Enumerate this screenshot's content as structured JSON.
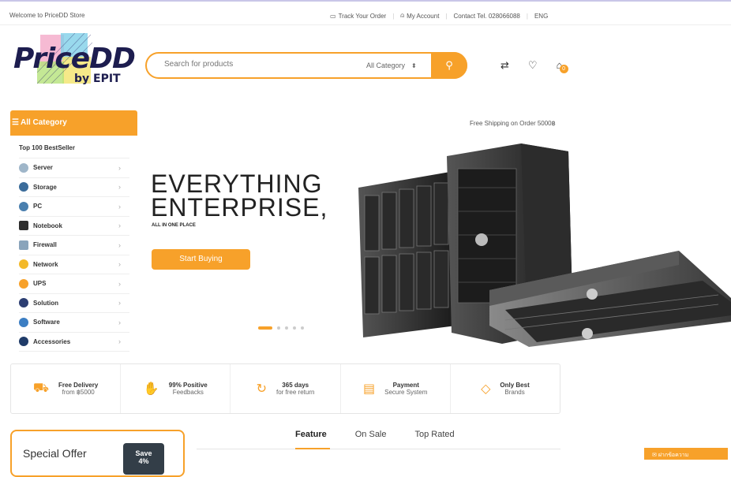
{
  "topbar": {
    "welcome": "Welcome to PriceDD Store",
    "track": "Track Your Order",
    "account": "My Account",
    "contact": "Contact Tel. 028066088",
    "lang": "ENG"
  },
  "logo": {
    "text": "PriceDD",
    "sub": "by EPIT"
  },
  "search": {
    "placeholder": "Search for products",
    "category": "All Category"
  },
  "header": {
    "cart_count": "0"
  },
  "sidebar": {
    "all_category": "All Category",
    "top100": "Top 100 BestSeller",
    "items": [
      {
        "label": "Server",
        "color": "#9fb6c9"
      },
      {
        "label": "Storage",
        "color": "#3b6c9a"
      },
      {
        "label": "PC",
        "color": "#4a7fae"
      },
      {
        "label": "Notebook",
        "color": "#2d2d2d"
      },
      {
        "label": "Firewall",
        "color": "#8aa4bb"
      },
      {
        "label": "Network",
        "color": "#f3b92a"
      },
      {
        "label": "UPS",
        "color": "#f7a12a"
      },
      {
        "label": "Solution",
        "color": "#2c3e72"
      },
      {
        "label": "Software",
        "color": "#3c7ec3"
      },
      {
        "label": "Accessories",
        "color": "#1f3b68"
      }
    ]
  },
  "hero": {
    "shipping": "Free Shipping on Order 5000฿",
    "line1": "EVERYTHING",
    "line2": "ENTERPRISE,",
    "sub": "ALL IN ONE PLACE",
    "cta": "Start Buying"
  },
  "features": [
    {
      "title": "Free Delivery",
      "sub": "from ฿5000",
      "icon": "truck-icon"
    },
    {
      "title": "99% Positive",
      "sub": "Feedbacks",
      "icon": "hand-icon"
    },
    {
      "title": "365 days",
      "sub": "for free return",
      "icon": "refresh-icon"
    },
    {
      "title": "Payment",
      "sub": "Secure System",
      "icon": "card-icon"
    },
    {
      "title": "Only Best",
      "sub": "Brands",
      "icon": "tag-icon"
    }
  ],
  "special": {
    "title": "Special Offer",
    "save": "Save",
    "save_amount": "4%"
  },
  "tabs": [
    "Feature",
    "On Sale",
    "Top Rated"
  ],
  "chat": {
    "label": "ฝากข้อความ"
  },
  "colors": {
    "accent": "#f7a12a",
    "dark": "#333e48"
  }
}
